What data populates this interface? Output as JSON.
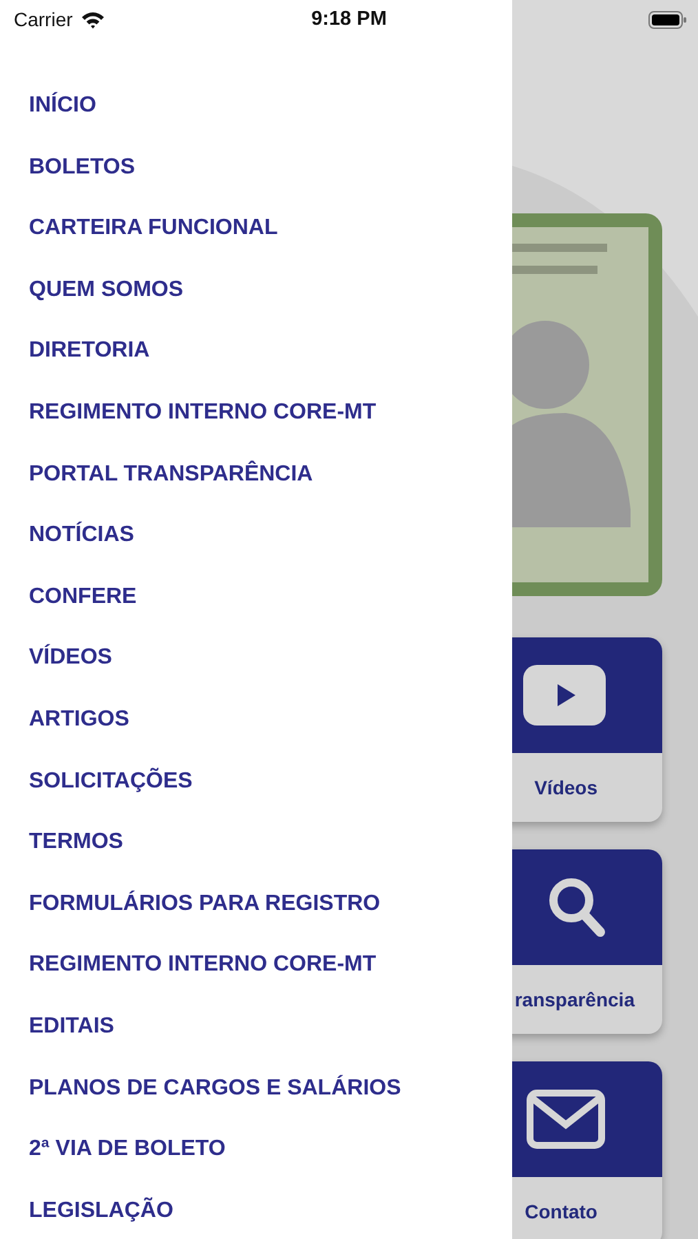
{
  "status_bar": {
    "carrier": "Carrier",
    "time": "9:18 PM"
  },
  "menu": {
    "items": [
      {
        "label": "INÍCIO"
      },
      {
        "label": "BOLETOS"
      },
      {
        "label": "CARTEIRA FUNCIONAL"
      },
      {
        "label": "QUEM SOMOS"
      },
      {
        "label": "DIRETORIA"
      },
      {
        "label": "REGIMENTO INTERNO CORE-MT"
      },
      {
        "label": "PORTAL TRANSPARÊNCIA"
      },
      {
        "label": "NOTÍCIAS"
      },
      {
        "label": "CONFERE"
      },
      {
        "label": "VÍDEOS"
      },
      {
        "label": "ARTIGOS"
      },
      {
        "label": "SOLICITAÇÕES"
      },
      {
        "label": "TERMOS"
      },
      {
        "label": "FORMULÁRIOS PARA REGISTRO"
      },
      {
        "label": "REGIMENTO INTERNO CORE-MT"
      },
      {
        "label": "EDITAIS"
      },
      {
        "label": "PLANOS DE CARGOS E SALÁRIOS"
      },
      {
        "label": "2ª VIA DE BOLETO"
      },
      {
        "label": "LEGISLAÇÃO"
      }
    ]
  },
  "background": {
    "tiles": [
      {
        "kind": "video",
        "label": "Vídeos"
      },
      {
        "kind": "search",
        "label": "ransparência"
      },
      {
        "kind": "mail",
        "label": "Contato"
      }
    ]
  }
}
